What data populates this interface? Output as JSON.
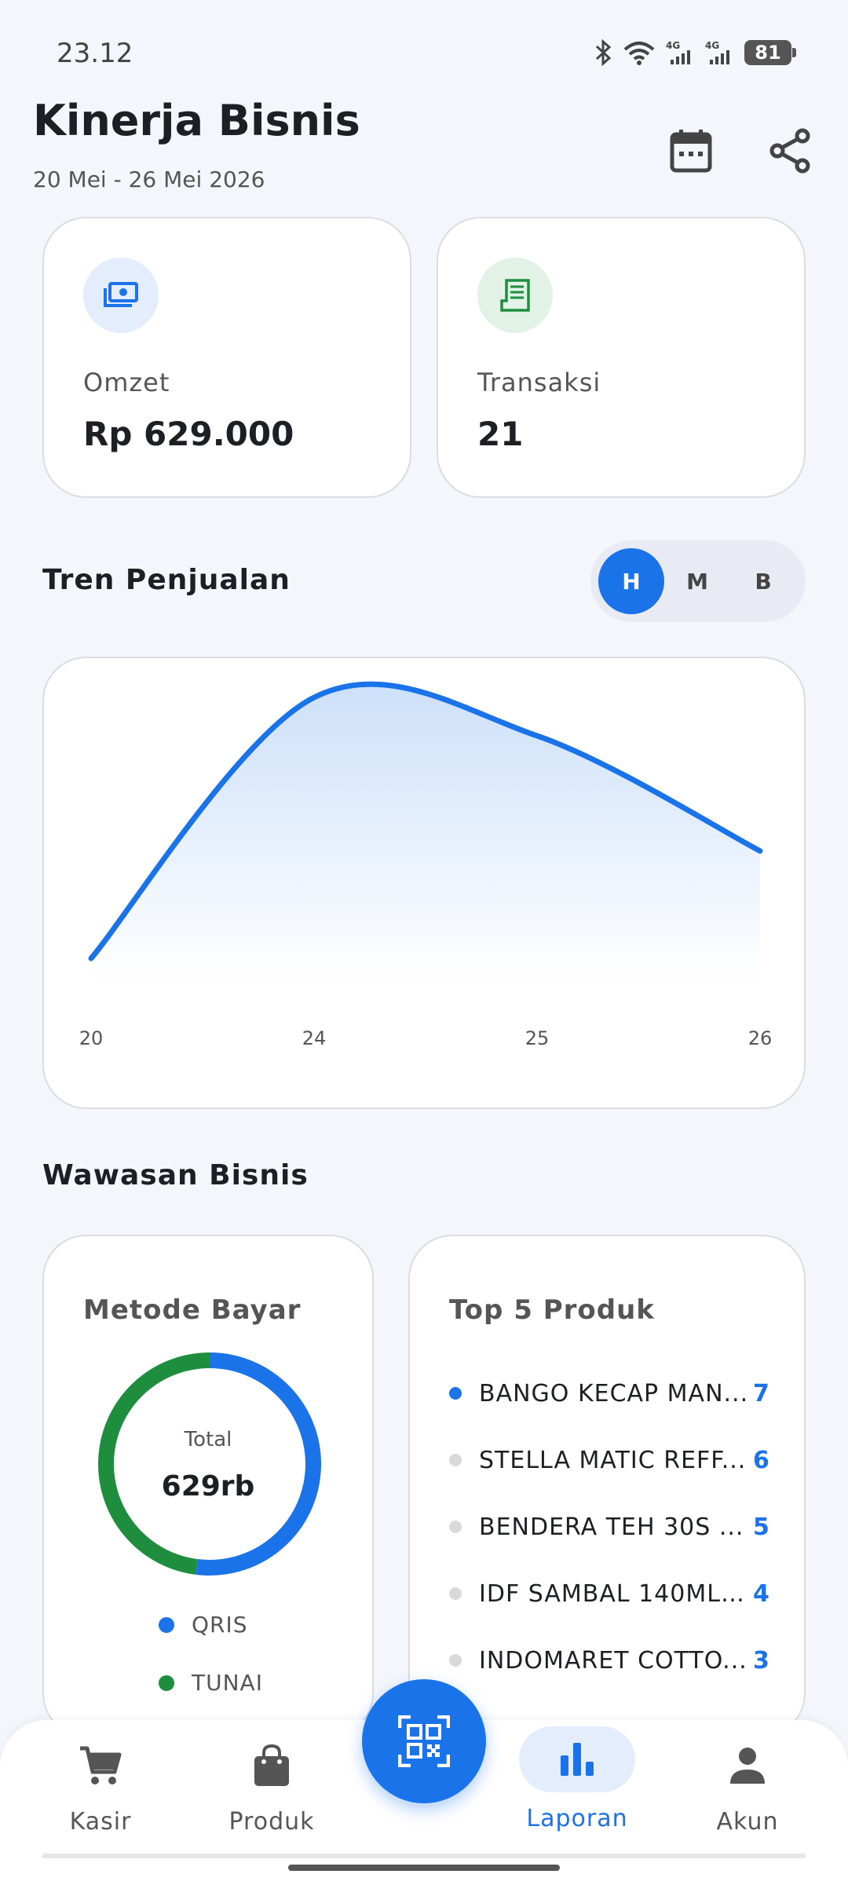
{
  "status_bar": {
    "time": "23.12",
    "battery": "81"
  },
  "header": {
    "title": "Kinerja Bisnis",
    "date_range": "20 Mei - 26 Mei 2026"
  },
  "stats": {
    "omzet": {
      "label": "Omzet",
      "value": "Rp 629.000",
      "icon": "money-icon"
    },
    "transaksi": {
      "label": "Transaksi",
      "value": "21",
      "icon": "receipt-icon"
    }
  },
  "trend": {
    "title": "Tren Penjualan",
    "period_options": [
      "H",
      "M",
      "B"
    ],
    "selected": "H"
  },
  "chart_data": {
    "type": "area",
    "categories": [
      "20",
      "24",
      "25",
      "26"
    ],
    "values": [
      6000,
      210000,
      180000,
      90000
    ],
    "xlabel": "",
    "ylabel": "",
    "grid": false,
    "color": "#1a73e8"
  },
  "insights": {
    "title": "Wawasan Bisnis",
    "payment": {
      "title": "Metode Bayar",
      "total_label": "Total",
      "total_value": "629rb",
      "methods": [
        {
          "name": "QRIS",
          "color": "#1a73e8",
          "share": 0.52
        },
        {
          "name": "TUNAI",
          "color": "#1e8e3e",
          "share": 0.48
        }
      ]
    },
    "top_products": {
      "title": "Top 5 Produk",
      "items": [
        {
          "name": "BANGO KECAP MAN...",
          "count": "7"
        },
        {
          "name": "STELLA MATIC REFF...",
          "count": "6"
        },
        {
          "name": "BENDERA TEH 30S ...",
          "count": "5"
        },
        {
          "name": "IDF SAMBAL 140ML ...",
          "count": "4"
        },
        {
          "name": "INDOMARET COTTO...",
          "count": "3"
        }
      ]
    }
  },
  "nav": {
    "items": [
      {
        "label": "Kasir",
        "icon": "cart-icon"
      },
      {
        "label": "Produk",
        "icon": "bag-icon"
      },
      {
        "label": "Laporan",
        "icon": "bar-chart-icon"
      },
      {
        "label": "Akun",
        "icon": "person-icon"
      }
    ],
    "active": "Laporan",
    "fab_icon": "qr-scan-icon"
  }
}
